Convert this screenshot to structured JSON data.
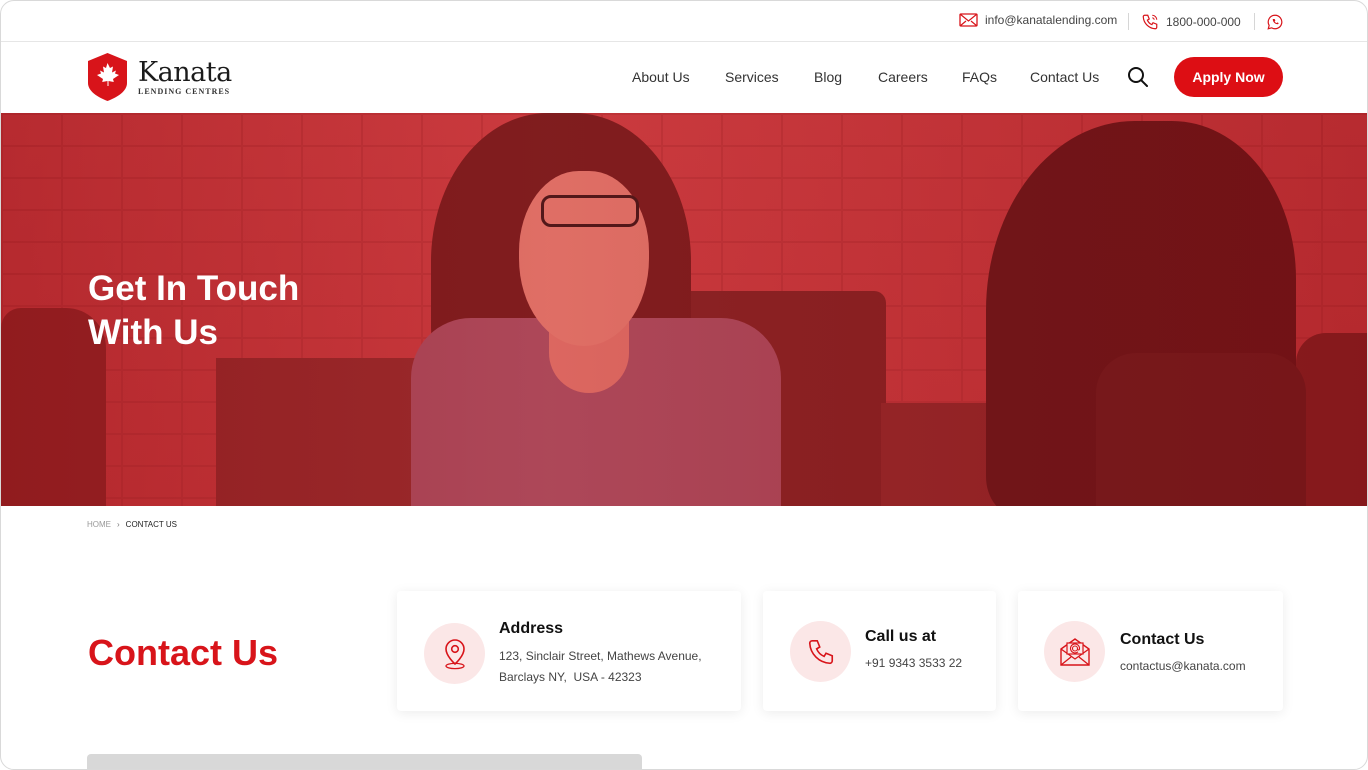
{
  "topbar": {
    "email": "info@kanatalending.com",
    "phone": "1800-000-000",
    "icons": {
      "email": "mail-icon",
      "phone": "phone-icon",
      "whatsapp": "whatsapp-icon"
    }
  },
  "brand": {
    "name": "Kanata",
    "subtitle": "LENDING CENTRES",
    "accent": "#d8141a"
  },
  "nav": {
    "items": [
      {
        "label": "About Us"
      },
      {
        "label": "Services"
      },
      {
        "label": "Blog"
      },
      {
        "label": "Careers"
      },
      {
        "label": "FAQs"
      },
      {
        "label": "Contact Us",
        "active": true
      }
    ],
    "apply_label": "Apply Now"
  },
  "hero": {
    "line1": "Get In Touch",
    "line2": "With Us"
  },
  "breadcrumb": {
    "home": "HOME",
    "current": "CONTACT US"
  },
  "contact": {
    "title": "Contact Us",
    "cards": [
      {
        "icon": "location-pin-icon",
        "title": "Address",
        "line1": "123, Sinclair Street, Mathews Avenue,",
        "line2": "Barclays NY,  USA - 42323"
      },
      {
        "icon": "phone-icon",
        "title": "Call us at",
        "line1": "+91 9343 3533 22"
      },
      {
        "icon": "envelope-at-icon",
        "title": "Contact Us",
        "line1": "contactus@kanata.com"
      }
    ]
  }
}
